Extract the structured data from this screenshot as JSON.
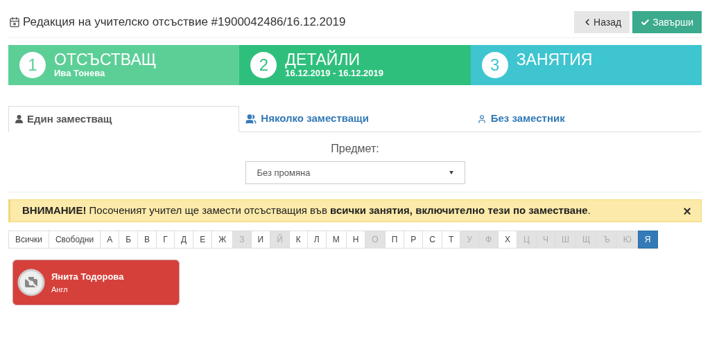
{
  "header": {
    "title": "Редакция на учителско отсъствие #1900042486/16.12.2019",
    "back_button": "Назад",
    "finish_button": "Завърши"
  },
  "steps": [
    {
      "number": "1",
      "title": "ОТСЪСТВАЩ",
      "subtitle": "Ива Тонева",
      "color": "#5ccf97"
    },
    {
      "number": "2",
      "title": "ДЕТАЙЛИ",
      "subtitle": "16.12.2019 - 16.12.2019",
      "color": "#2fbf7d"
    },
    {
      "number": "3",
      "title": "ЗАНЯТИЯ",
      "color": "#3ec5d0"
    }
  ],
  "tabs": [
    {
      "label": "Един заместващ",
      "kind": "user",
      "selected": true
    },
    {
      "label": "Няколко заместващи",
      "kind": "users",
      "selected": false
    },
    {
      "label": "Без заместник",
      "kind": "user-outline",
      "selected": false
    }
  ],
  "subject": {
    "label": "Предмет:",
    "value": "Без промяна"
  },
  "alert": {
    "text": "**ВНИМАНИЕ!** Посоченият учител ще замести отсъстващия във **всички занятия, включително тези по заместване**.",
    "close": "×"
  },
  "filters": [
    {
      "label": "Всички",
      "disabled": false,
      "selected": false
    },
    {
      "label": "Свободни",
      "disabled": false,
      "selected": false
    },
    {
      "label": "А",
      "disabled": false,
      "selected": false
    },
    {
      "label": "Б",
      "disabled": false,
      "selected": false
    },
    {
      "label": "В",
      "disabled": false,
      "selected": false
    },
    {
      "label": "Г",
      "disabled": false,
      "selected": false
    },
    {
      "label": "Д",
      "disabled": false,
      "selected": false
    },
    {
      "label": "Е",
      "disabled": false,
      "selected": false
    },
    {
      "label": "Ж",
      "disabled": false,
      "selected": false
    },
    {
      "label": "З",
      "disabled": true,
      "selected": false
    },
    {
      "label": "И",
      "disabled": false,
      "selected": false
    },
    {
      "label": "Й",
      "disabled": true,
      "selected": false
    },
    {
      "label": "К",
      "disabled": false,
      "selected": false
    },
    {
      "label": "Л",
      "disabled": false,
      "selected": false
    },
    {
      "label": "М",
      "disabled": false,
      "selected": false
    },
    {
      "label": "Н",
      "disabled": false,
      "selected": false
    },
    {
      "label": "О",
      "disabled": true,
      "selected": false
    },
    {
      "label": "П",
      "disabled": false,
      "selected": false
    },
    {
      "label": "Р",
      "disabled": false,
      "selected": false
    },
    {
      "label": "С",
      "disabled": false,
      "selected": false
    },
    {
      "label": "Т",
      "disabled": false,
      "selected": false
    },
    {
      "label": "У",
      "disabled": true,
      "selected": false
    },
    {
      "label": "Ф",
      "disabled": true,
      "selected": false
    },
    {
      "label": "Х",
      "disabled": false,
      "selected": false
    },
    {
      "label": "Ц",
      "disabled": true,
      "selected": false
    },
    {
      "label": "Ч",
      "disabled": true,
      "selected": false
    },
    {
      "label": "Ш",
      "disabled": true,
      "selected": false
    },
    {
      "label": "Щ",
      "disabled": true,
      "selected": false
    },
    {
      "label": "Ъ",
      "disabled": true,
      "selected": false
    },
    {
      "label": "Ю",
      "disabled": true,
      "selected": false
    },
    {
      "label": "Я",
      "disabled": false,
      "selected": true
    }
  ],
  "teachers": [
    {
      "name": "Янита Тодорова",
      "subject": "Англ"
    }
  ]
}
